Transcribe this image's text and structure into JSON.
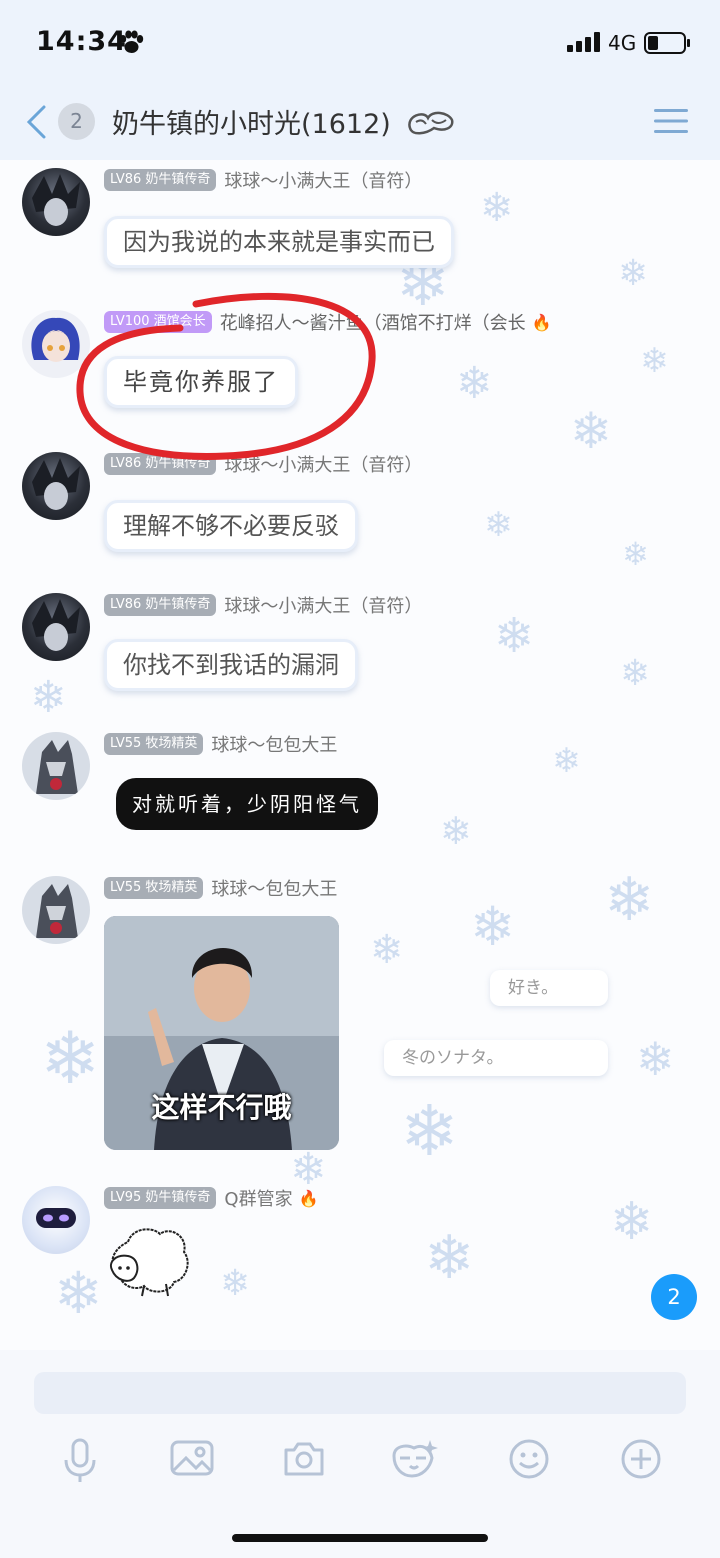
{
  "status_bar": {
    "time": "14:34",
    "network": "4G"
  },
  "nav": {
    "unread_count": "2",
    "title": "奶牛镇的小时光(1612)"
  },
  "messages": [
    {
      "level": "LV86",
      "title": "奶牛镇传奇",
      "nick": "球球～小满大王（音符）",
      "text": "因为我说的本来就是事实而已"
    },
    {
      "level": "LV100",
      "title": "酒馆会长",
      "nick": "花峰招人～酱汁鱼（酒馆不打烊（会长",
      "text": "毕竟你养服了"
    },
    {
      "level": "LV86",
      "title": "奶牛镇传奇",
      "nick": "球球～小满大王（音符）",
      "text": "理解不够不必要反驳"
    },
    {
      "level": "LV86",
      "title": "奶牛镇传奇",
      "nick": "球球～小满大王（音符）",
      "text": "你找不到我话的漏洞"
    },
    {
      "level": "LV55",
      "title": "牧场精英",
      "nick": "球球～包包大王",
      "text": "对就听着，少阴阳怪气"
    },
    {
      "level": "LV55",
      "title": "牧场精英",
      "nick": "球球～包包大王",
      "image_caption": "这样不行哦"
    },
    {
      "level": "LV95",
      "title": "奶牛镇传奇",
      "nick": "Q群管家"
    }
  ],
  "decorations": {
    "tag1": "好き。",
    "tag2": "冬のソナタ。"
  },
  "new_message_badge": "2",
  "colors": {
    "accent": "#1a9cfb",
    "level_badge": "#a7adb5",
    "level_badge_owner": "#c19af7",
    "annotation_red": "#e0262a"
  }
}
